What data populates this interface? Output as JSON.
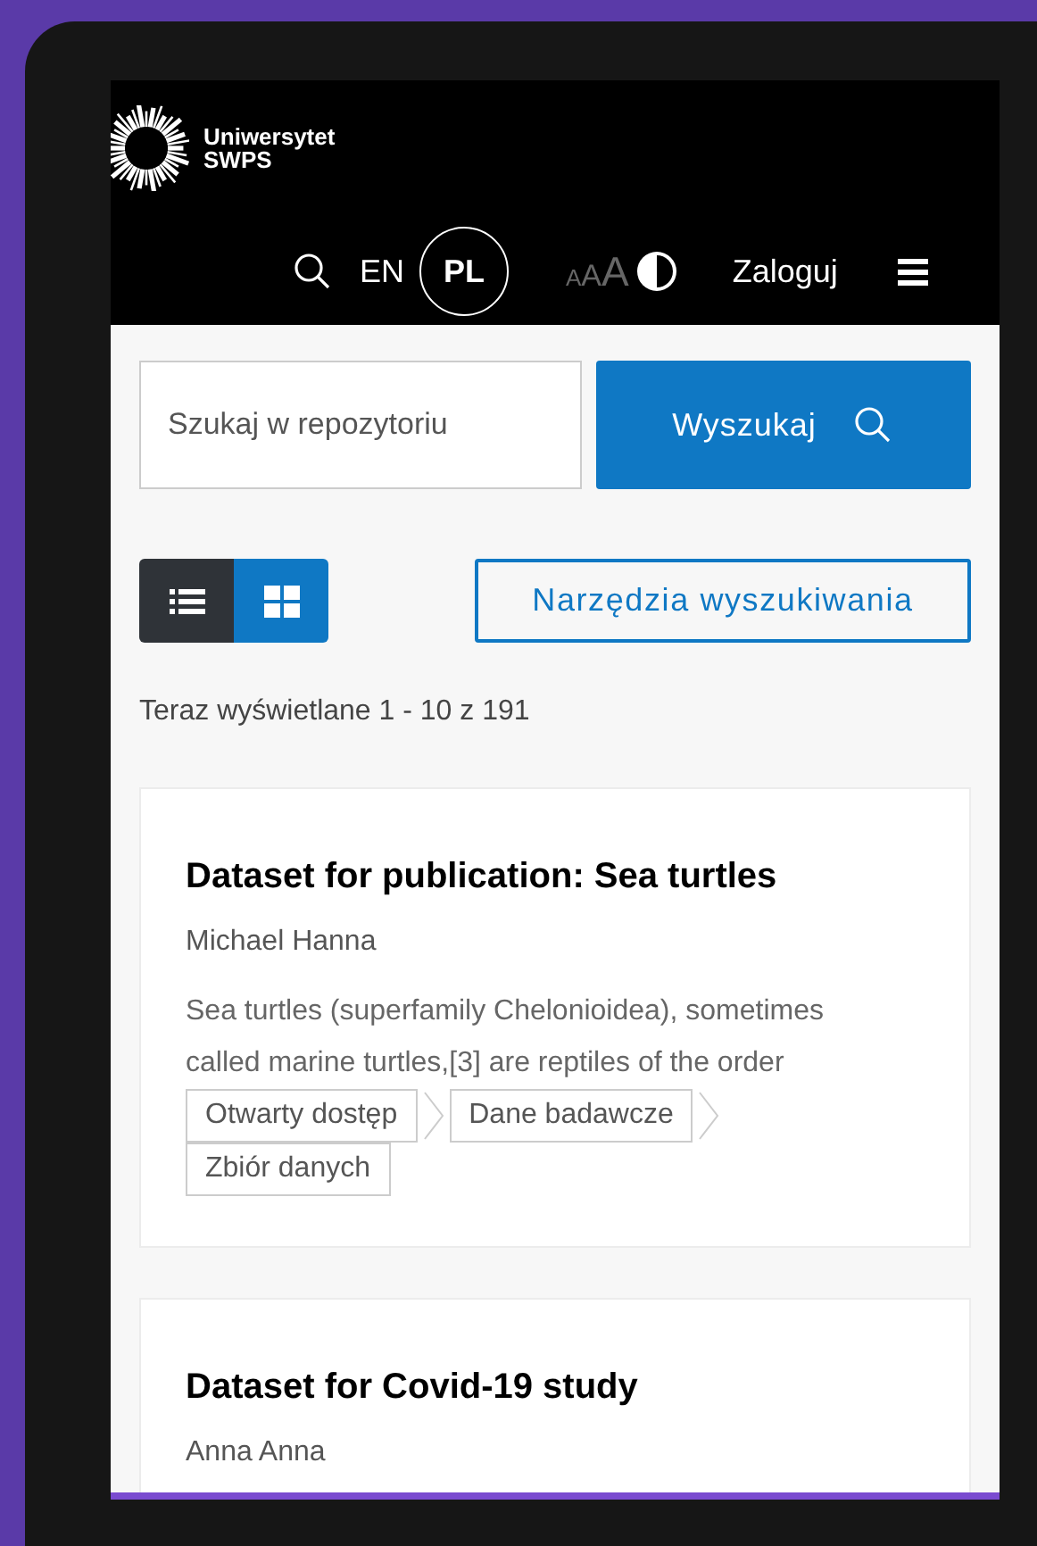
{
  "header": {
    "logo_lines": [
      "Uniwersytet",
      "SWPS"
    ],
    "languages": [
      {
        "label": "EN",
        "selected": false
      },
      {
        "label": "PL",
        "selected": true
      }
    ],
    "text_size_letters": [
      "A",
      "A",
      "A"
    ],
    "login": "Zaloguj"
  },
  "search": {
    "placeholder": "Szukaj w repozytoriu",
    "button": "Wyszukaj"
  },
  "view_modes": [
    {
      "kind": "list",
      "selected": true
    },
    {
      "kind": "grid",
      "selected": false
    }
  ],
  "tools_button": "Narzędzia wyszukiwania",
  "results_count": "Teraz wyświetlane 1 - 10 z 191",
  "results": [
    {
      "title": "Dataset for publication: Sea turtles",
      "author": "Michael Hanna",
      "abstract": "Sea turtles (superfamily Chelonioidea), sometimes called marine turtles,[3] are reptiles of the order",
      "tags": [
        "Otwarty dostęp",
        "Dane badawcze",
        "Zbiór danych"
      ]
    },
    {
      "title": "Dataset for Covid-19 study",
      "author": "Anna Anna"
    }
  ]
}
